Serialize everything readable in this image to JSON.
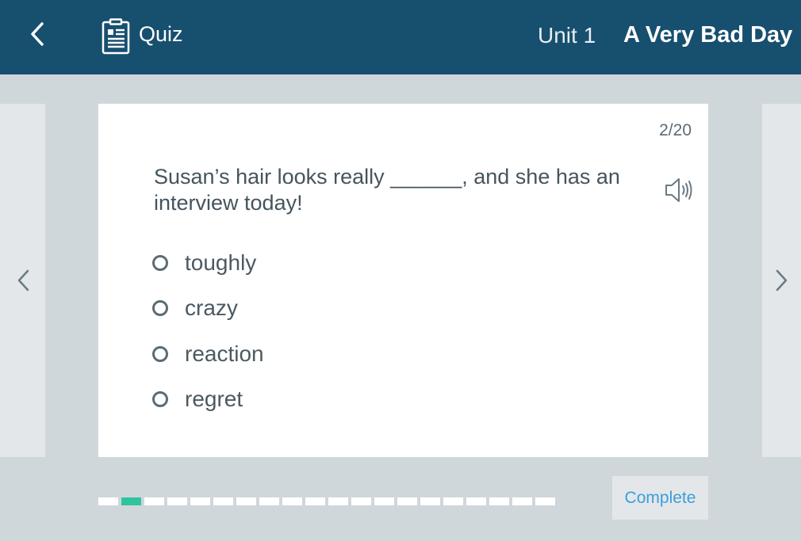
{
  "header": {
    "quiz_label": "Quiz",
    "unit": "Unit 1",
    "title": "A Very Bad Day",
    "background_color": "#174f6f"
  },
  "icons": {
    "back": "chevron-left-icon",
    "quiz": "document-icon",
    "speaker": "speaker-icon",
    "prev": "chevron-left-icon",
    "next": "chevron-right-icon"
  },
  "question": {
    "counter": "2/20",
    "text": "Susan’s hair looks really ______, and she has an interview today!",
    "options": [
      "toughly",
      "crazy",
      "reaction",
      "regret"
    ]
  },
  "progress": {
    "total": 20,
    "current": 2,
    "active_color": "#2ec4a0"
  },
  "footer": {
    "complete_label": "Complete"
  }
}
